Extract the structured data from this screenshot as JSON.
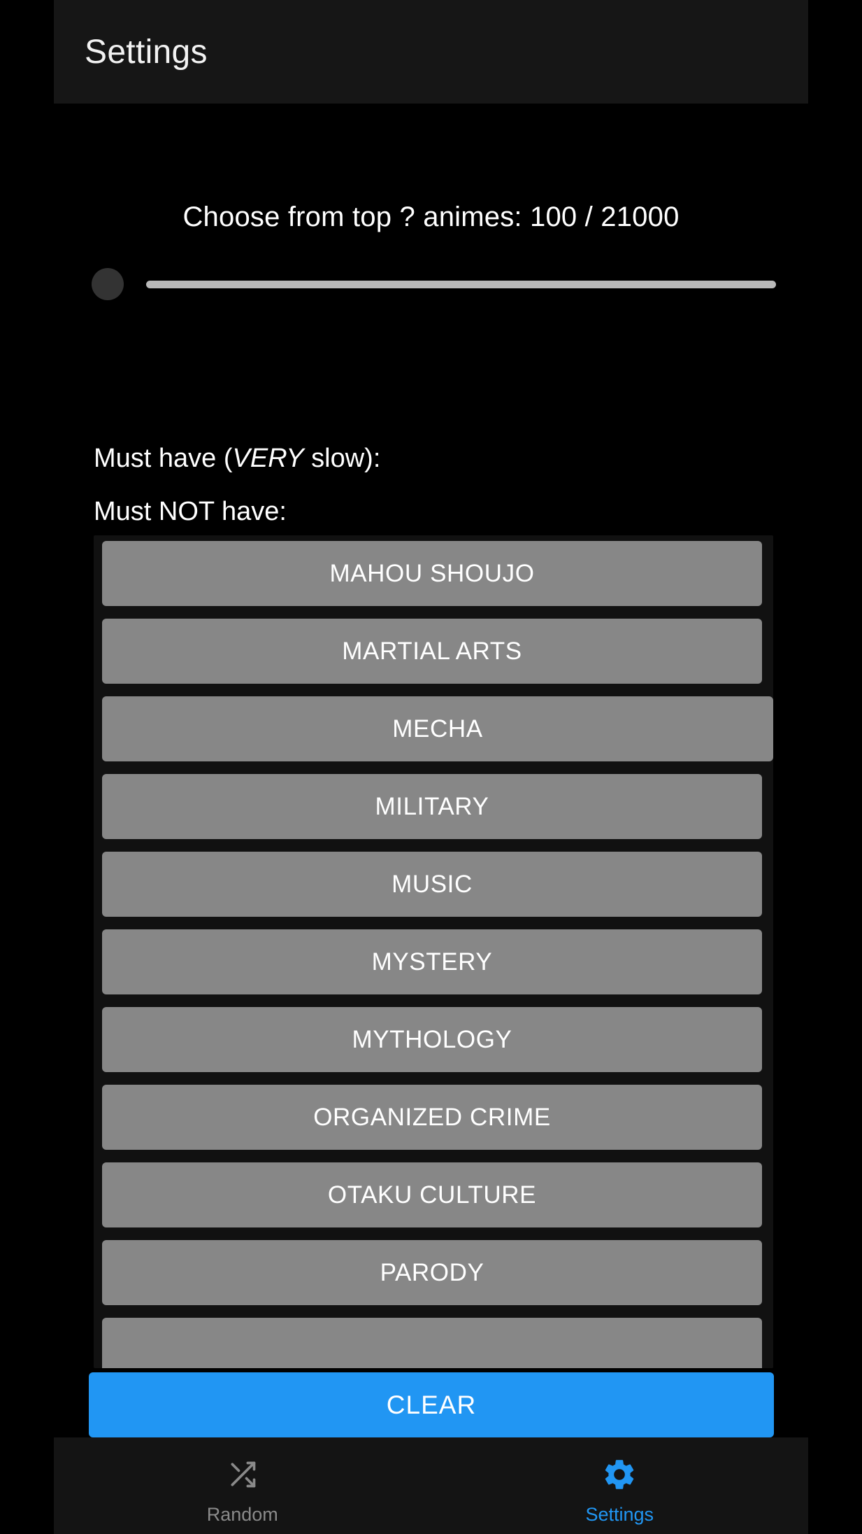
{
  "header": {
    "title": "Settings"
  },
  "slider": {
    "label": "Choose from top ? animes: 100 / 21000",
    "value": 100,
    "max": 21000,
    "thumb_position_percent": 0,
    "track_color": "#b9b9b9",
    "thumb_color": "#333333"
  },
  "filters": {
    "must_have_prefix": "Must have (",
    "must_have_emphasis": "VERY",
    "must_have_suffix": " slow):",
    "must_not_have_label": "Must NOT have:"
  },
  "genres": [
    {
      "label": "MAHOU SHOUJO",
      "wide": false
    },
    {
      "label": "MARTIAL ARTS",
      "wide": false
    },
    {
      "label": "MECHA",
      "wide": true
    },
    {
      "label": "MILITARY",
      "wide": false
    },
    {
      "label": "MUSIC",
      "wide": false
    },
    {
      "label": "MYSTERY",
      "wide": false
    },
    {
      "label": "MYTHOLOGY",
      "wide": false
    },
    {
      "label": "ORGANIZED CRIME",
      "wide": false
    },
    {
      "label": "OTAKU CULTURE",
      "wide": false
    },
    {
      "label": "PARODY",
      "wide": false
    },
    {
      "label": "",
      "wide": false
    }
  ],
  "actions": {
    "clear_label": "CLEAR",
    "clear_color": "#2196f3"
  },
  "bottom_nav": {
    "items": [
      {
        "label": "Random",
        "icon": "shuffle-icon",
        "active": false,
        "color": "#8a8a8a"
      },
      {
        "label": "Settings",
        "icon": "gear-icon",
        "active": true,
        "color": "#2196f3"
      }
    ]
  }
}
